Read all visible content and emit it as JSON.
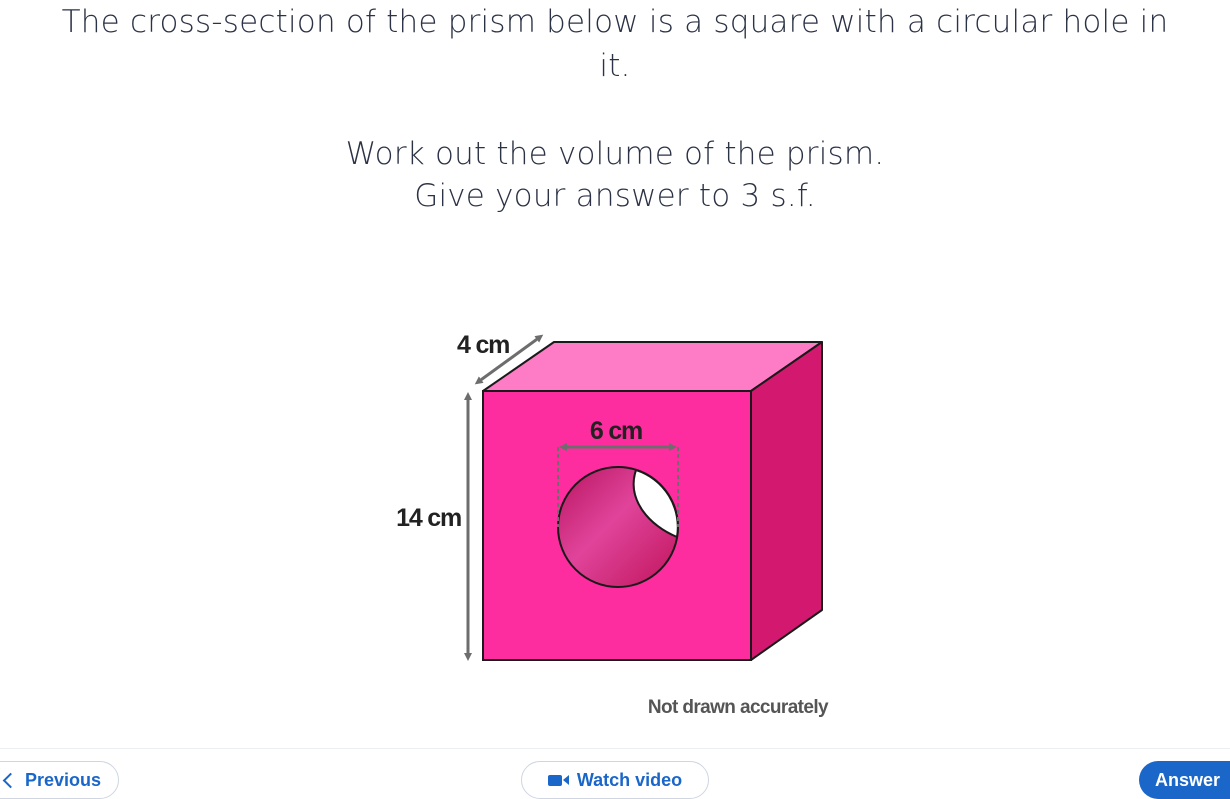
{
  "question": {
    "line1": "The cross-section of the prism below is a square with a circular hole in",
    "line2": "it.",
    "line3": "Work out the volume of the prism.",
    "line4": "Give your answer to 3 s.f."
  },
  "figure": {
    "depth_label": "4 cm",
    "diameter_label": "6 cm",
    "height_label": "14 cm",
    "note": "Not drawn accurately",
    "colors": {
      "front_face": "#fe2d9f",
      "top_face": "#fe7cc6",
      "side_face": "#d3196f",
      "arrow": "#6d6d6d"
    }
  },
  "nav": {
    "previous_label": "Previous",
    "previous_icon": "chevron-left-icon",
    "video_label": "Watch video",
    "video_icon": "video-camera-icon",
    "answer_label": "Answer",
    "accent_color": "#1a66c9"
  }
}
